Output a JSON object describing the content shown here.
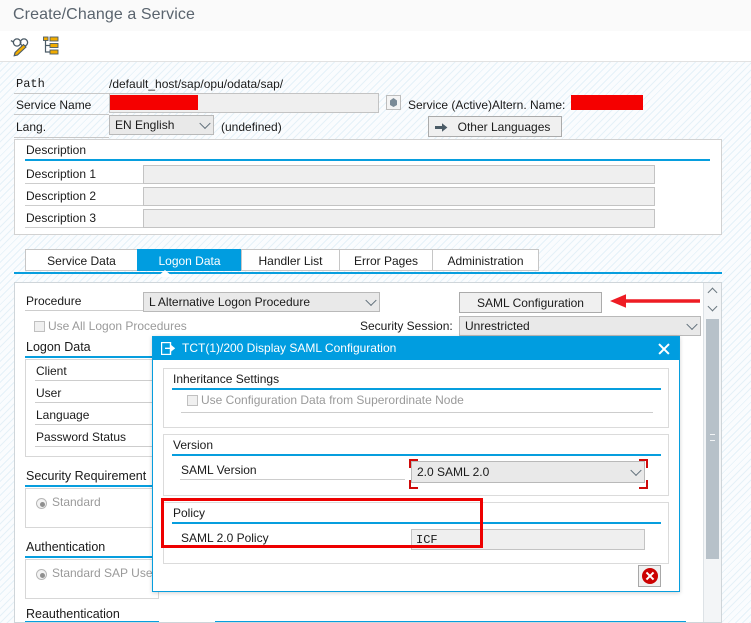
{
  "app": {
    "title": "Create/Change a Service"
  },
  "toolbar": {
    "buttons": [
      {
        "name": "display-change-icon",
        "tooltip": "Display/Change"
      },
      {
        "name": "hierarchy-icon",
        "tooltip": "Hierarchy"
      }
    ]
  },
  "header": {
    "path_label": "Path",
    "path_value": "/default_host/sap/opu/odata/sap/",
    "service_name_label": "Service Name",
    "service_name_value": "",
    "service_name_redacted": true,
    "service_state": "Service (Active)",
    "alt_name_label": "Altern. Name:",
    "alt_name_value": "",
    "alt_name_redacted": true,
    "lang_label": "Lang.",
    "lang_value": "EN English",
    "lang_suffix": "(undefined)",
    "other_languages_button": "Other Languages"
  },
  "description": {
    "group_title": "Description",
    "rows": [
      {
        "label": "Description 1",
        "value": ""
      },
      {
        "label": "Description 2",
        "value": ""
      },
      {
        "label": "Description 3",
        "value": ""
      }
    ]
  },
  "tabs": [
    {
      "label": "Service Data",
      "active": false
    },
    {
      "label": "Logon Data",
      "active": true
    },
    {
      "label": "Handler List",
      "active": false
    },
    {
      "label": "Error Pages",
      "active": false
    },
    {
      "label": "Administration",
      "active": false
    }
  ],
  "logon": {
    "procedure_label": "Procedure",
    "procedure_value": "L Alternative Logon Procedure",
    "saml_config_button": "SAML Configuration",
    "use_all_logon_label": "Use All Logon Procedures",
    "use_all_logon_checked": false,
    "security_session_label": "Security Session:",
    "security_session_value": "Unrestricted",
    "logon_data_group": "Logon Data",
    "logon_fields": [
      {
        "label": "Client",
        "value": ""
      },
      {
        "label": "User",
        "value": ""
      },
      {
        "label": "Language",
        "value": ""
      },
      {
        "label": "Password Status",
        "value": ""
      }
    ],
    "security_requirement_group": "Security Requirement",
    "security_requirement_option": "Standard",
    "authentication_group": "Authentication",
    "authentication_option": "Standard SAP User",
    "reauthentication_group": "Reauthentication"
  },
  "dialog": {
    "title": "TCT(1)/200 Display SAML Configuration",
    "title_icon": "dialog-window-icon",
    "close_icon": "close-icon",
    "inheritance": {
      "group_title": "Inheritance Settings",
      "checkbox_label": "Use Configuration Data from Superordinate Node",
      "checked": false
    },
    "version": {
      "group_title": "Version",
      "field_label": "SAML Version",
      "field_value": "2.0 SAML 2.0"
    },
    "policy": {
      "group_title": "Policy",
      "field_label": "SAML 2.0 Policy",
      "field_value": "ICF"
    },
    "cancel_button_icon": "cancel-icon"
  },
  "annotations": {
    "arrow_target": "SAML Configuration",
    "highlight_box": "Policy"
  },
  "colors": {
    "accent": "#009de0",
    "rule": "#079ede",
    "redaction": "#f50000",
    "annotation": "#ee0000",
    "focus": "#cf0a0a"
  }
}
